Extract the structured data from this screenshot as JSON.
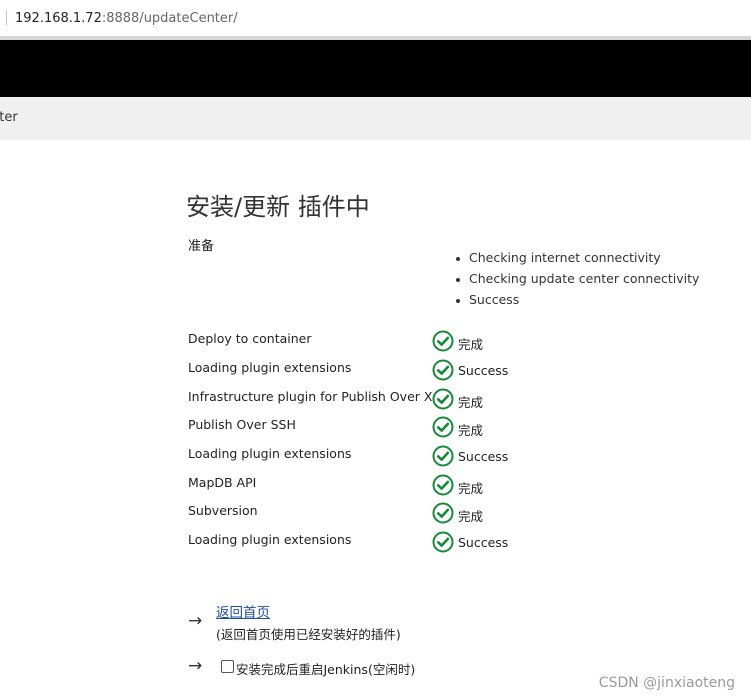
{
  "address_bar": {
    "host": "192.168.1.72",
    "path": ":8888/updateCenter/"
  },
  "breadcrumb": {
    "label": "nter"
  },
  "page": {
    "title": "安装/更新 插件中"
  },
  "preparation": {
    "label": "准备",
    "checks": [
      "Checking internet connectivity",
      "Checking update center connectivity",
      "Success"
    ]
  },
  "plugins": [
    {
      "name": "Deploy to container",
      "status": "完成"
    },
    {
      "name": "Loading plugin extensions",
      "status": "Success"
    },
    {
      "name": "Infrastructure plugin for Publish Over X",
      "status": "完成"
    },
    {
      "name": "Publish Over SSH",
      "status": "完成"
    },
    {
      "name": "Loading plugin extensions",
      "status": "Success"
    },
    {
      "name": "MapDB API",
      "status": "完成"
    },
    {
      "name": "Subversion",
      "status": "完成"
    },
    {
      "name": "Loading plugin extensions",
      "status": "Success"
    }
  ],
  "actions": {
    "back_link": "返回首页",
    "back_desc": "(返回首页使用已经安装好的插件)",
    "restart_label": "安装完成后重启Jenkins(空闲时)",
    "restart_checked": false
  },
  "icons": {
    "status": "check-circle-icon",
    "arrow": "arrow-right-icon"
  },
  "colors": {
    "success": "#138a36",
    "link": "#1d4fa6",
    "header": "#000000"
  },
  "watermark": "CSDN @jinxiaoteng"
}
